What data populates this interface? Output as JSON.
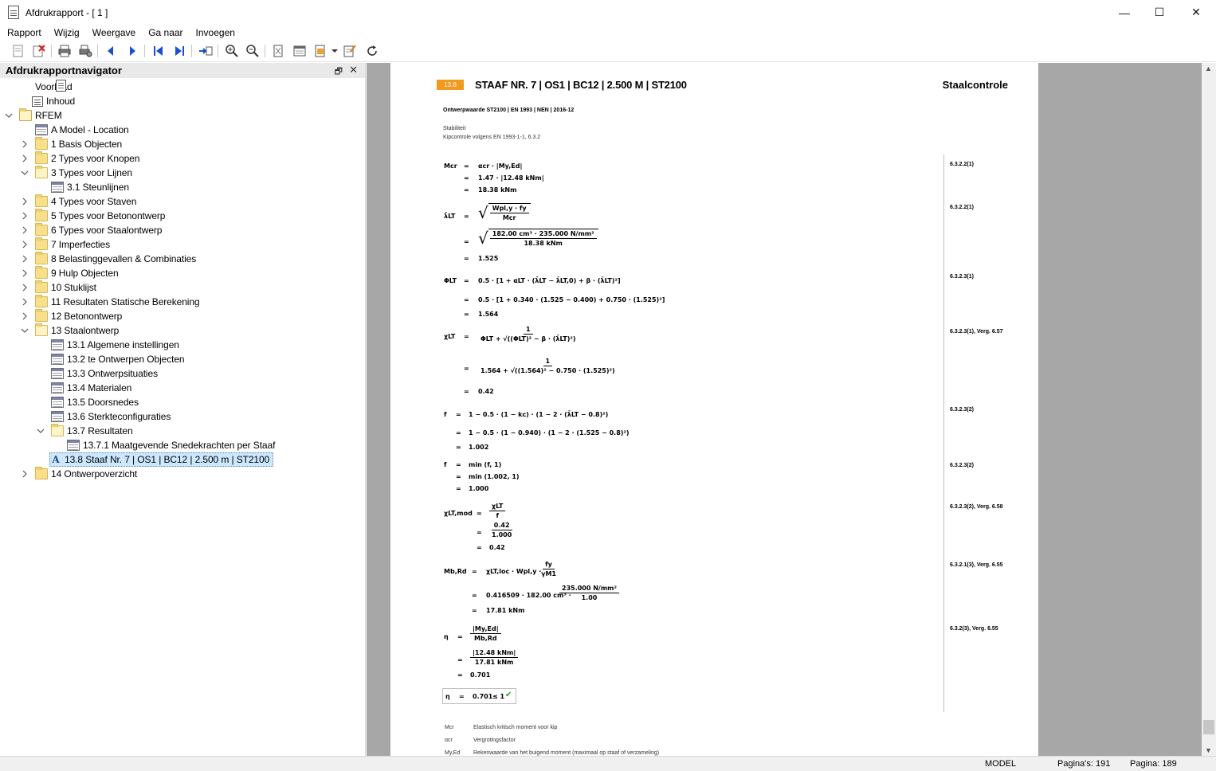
{
  "window": {
    "title": "Afdrukrapport - [ 1 ]",
    "minimize_glyph": "—",
    "maximize_glyph": "☐",
    "close_glyph": "✕"
  },
  "menu": [
    "Rapport",
    "Wijzig",
    "Weergave",
    "Ga naar",
    "Invoegen"
  ],
  "toolbar_icons": [
    "new-page-icon",
    "delete-icon",
    "print-icon",
    "print-setup-icon",
    "arrow-left-icon",
    "arrow-right-icon",
    "first-page-icon",
    "last-page-icon",
    "goto-page-icon",
    "zoom-in-icon",
    "zoom-out-icon",
    "fit-page-icon",
    "page-setup-icon",
    "export-icon",
    "dropdown-icon",
    "edit-icon",
    "refresh-icon"
  ],
  "navigator": {
    "title": "Afdrukrapportnavigator",
    "pin_glyph": "🗗",
    "close_glyph": "✕",
    "items": [
      {
        "label": "Voorblad",
        "icon": "page",
        "level": 1,
        "expander": ""
      },
      {
        "label": "Inhoud",
        "icon": "toc",
        "level": 1,
        "expander": ""
      },
      {
        "label": "RFEM",
        "icon": "rfem",
        "level": 0,
        "expander": "open"
      },
      {
        "label": "A Model - Location",
        "icon": "table",
        "level": 2,
        "expander": ""
      },
      {
        "label": "1 Basis Objecten",
        "icon": "folder",
        "level": 2,
        "expander": "closed"
      },
      {
        "label": "2 Types voor Knopen",
        "icon": "folder",
        "level": 2,
        "expander": "closed"
      },
      {
        "label": "3 Types voor Lijnen",
        "icon": "folder-open",
        "level": 2,
        "expander": "open"
      },
      {
        "label": "3.1 Steunlijnen",
        "icon": "table",
        "level": 3,
        "expander": ""
      },
      {
        "label": "4 Types voor Staven",
        "icon": "folder",
        "level": 2,
        "expander": "closed"
      },
      {
        "label": "5 Types voor Betonontwerp",
        "icon": "folder",
        "level": 2,
        "expander": "closed"
      },
      {
        "label": "6 Types voor Staalontwerp",
        "icon": "folder",
        "level": 2,
        "expander": "closed"
      },
      {
        "label": "7 Imperfecties",
        "icon": "folder",
        "level": 2,
        "expander": "closed"
      },
      {
        "label": "8 Belastinggevallen & Combinaties",
        "icon": "folder",
        "level": 2,
        "expander": "closed"
      },
      {
        "label": "9 Hulp Objecten",
        "icon": "folder",
        "level": 2,
        "expander": "closed"
      },
      {
        "label": "10 Stuklijst",
        "icon": "folder",
        "level": 2,
        "expander": "closed"
      },
      {
        "label": "11 Resultaten Statische Berekening",
        "icon": "folder",
        "level": 2,
        "expander": "closed"
      },
      {
        "label": "12 Betonontwerp",
        "icon": "folder",
        "level": 2,
        "expander": "closed"
      },
      {
        "label": "13 Staalontwerp",
        "icon": "folder-open",
        "level": 2,
        "expander": "open"
      },
      {
        "label": "13.1 Algemene instellingen",
        "icon": "table",
        "level": 3,
        "expander": ""
      },
      {
        "label": "13.2 te Ontwerpen Objecten",
        "icon": "table",
        "level": 3,
        "expander": ""
      },
      {
        "label": "13.3 Ontwerpsituaties",
        "icon": "table",
        "level": 3,
        "expander": ""
      },
      {
        "label": "13.4 Materialen",
        "icon": "table",
        "level": 3,
        "expander": ""
      },
      {
        "label": "13.5 Doorsnedes",
        "icon": "table",
        "level": 3,
        "expander": ""
      },
      {
        "label": "13.6 Sterkteconfiguraties",
        "icon": "table",
        "level": 3,
        "expander": ""
      },
      {
        "label": "13.7 Resultaten",
        "icon": "folder-open",
        "level": 3,
        "expander": "open"
      },
      {
        "label": "13.7.1 Maatgevende Snedekrachten per Staaf",
        "icon": "table",
        "level": 4,
        "expander": ""
      },
      {
        "label": "13.8 Staaf Nr. 7 | OS1 | BC12 | 2.500 m | ST2100",
        "icon": "letter",
        "level": 3,
        "expander": "",
        "selected": true
      },
      {
        "label": "14 Ontwerpoverzicht",
        "icon": "folder",
        "level": 2,
        "expander": "closed"
      }
    ]
  },
  "report": {
    "section_number": "13.8",
    "heading": "STAAF NR. 7 | OS1 | BC12 | 2.500 M | ST2100",
    "heading_right": "Staalcontrole",
    "subheading": "Ontwerpwaarde ST2100 | EN 1993 | NEN | 2016-12",
    "sub1": "Stabiliteit",
    "sub2": "Kipcontrole volgens EN 1993-1-1, 6.3.2",
    "refs": [
      "6.3.2.2(1)",
      "6.3.2.2(1)",
      "6.3.2.3(1)",
      "6.3.2.3(1), Verg. 6.57",
      "6.3.2.3(2)",
      "6.3.2.3(2)",
      "6.3.2.3(2), Verg. 6.58",
      "6.3.2.1(3), Verg. 6.55",
      "6.3.2(3), Verg. 6.55"
    ],
    "eq": {
      "mcr_sym": "Mcr",
      "mcr_1": "αcr · |My,Ed|",
      "mcr_2": "1.47 · |12.48 kNm|",
      "mcr_3": "18.38 kNm",
      "lam_sym": "λ̄LT",
      "lam_num": "Wpl,y · fy",
      "lam_den": "Mcr",
      "lam2_num": "182.00 cm³ · 235.000 N/mm²",
      "lam2_den": "18.38 kNm",
      "lam_3": "1.525",
      "phi_sym": "ΦLT",
      "phi_1": "0.5 · [1 + αLT · (λ̄LT − λ̄LT,0) + β · (λ̄LT)²]",
      "phi_2": "0.5 · [1 + 0.340 · (1.525 − 0.400) + 0.750 · (1.525)²]",
      "phi_3": "1.564",
      "chi_sym": "χLT",
      "chi_num": "1",
      "chi_den": "ΦLT + √((ΦLT)² − β · (λ̄LT)²)",
      "chi2_num": "1",
      "chi2_den": "1.564 + √((1.564)² − 0.750 · (1.525)²)",
      "chi_3": "0.42",
      "f_sym": "f",
      "f_1": "1 − 0.5 · (1 − kc) · (1 − 2 · (λ̄LT − 0.8)²)",
      "f_2": "1 − 0.5 · (1 − 0.940) · (1 − 2 · (1.525 − 0.8)²)",
      "f_3": "1.002",
      "fm_sym": "f",
      "fm_1": "min (f, 1)",
      "fm_2": "min (1.002, 1)",
      "fm_3": "1.000",
      "chim_sym": "χLT,mod",
      "chim_num": "χLT",
      "chim_den": "f",
      "chim2_num": "0.42",
      "chim2_den": "1.000",
      "chim_3": "0.42",
      "mb_sym": "Mb,Rd",
      "mb_1a": "χLT,loc · Wpl,y ·",
      "mb_1num": "fy",
      "mb_1den": "γM1",
      "mb_2a": "0.416509 · 182.00 cm³ ·",
      "mb_2num": "235.000 N/mm²",
      "mb_2den": "1.00",
      "mb_3": "17.81 kNm",
      "eta_sym": "η",
      "eta_num": "|My,Ed|",
      "eta_den": "Mb,Rd",
      "eta2_num": "|12.48 kNm|",
      "eta2_den": "17.81 kNm",
      "eta_3": "0.701",
      "res_sym": "η",
      "res_val": "0.701",
      "res_cmp": "≤ 1",
      "res_check": "✔"
    },
    "legend": [
      {
        "sym": "Mcr",
        "text": "Elastisch kritisch moment voor kip"
      },
      {
        "sym": "αcr",
        "text": "Vergrotingsfactor"
      },
      {
        "sym": "My,Ed",
        "text": "Rekenwaarde van het buigend moment (maximaal op staaf of verzameling)"
      }
    ]
  },
  "status": {
    "mode": "MODEL",
    "pages": "Pagina's: 191",
    "page": "Pagina: 189"
  }
}
